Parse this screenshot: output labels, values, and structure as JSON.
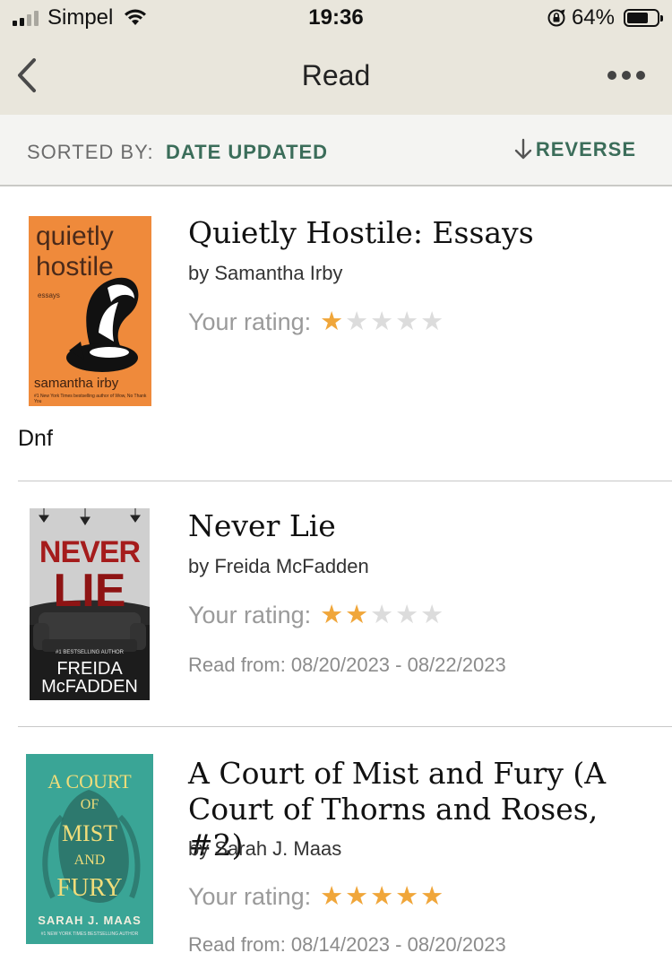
{
  "status_bar": {
    "carrier": "Simpel",
    "time": "19:36",
    "battery_percent": "64%",
    "battery_level": 0.64
  },
  "nav": {
    "title": "Read",
    "back_icon": "chevron-left-icon",
    "more_icon": "more-horizontal-icon"
  },
  "sort": {
    "label": "SORTED BY:",
    "value": "DATE UPDATED",
    "reverse_label": "REVERSE"
  },
  "colors": {
    "accent": "#3b6d5a",
    "star_on": "#f0a63a",
    "star_off": "#dcdcdc",
    "header_bg": "#e9e6dc"
  },
  "books": [
    {
      "title": "Quietly Hostile: Essays",
      "author": "by Samantha Irby",
      "rating_label": "Your rating:",
      "rating": 1,
      "max_rating": 5,
      "read_dates": "",
      "review": "Dnf",
      "cover": {
        "title_line1": "quietly",
        "title_line2": "hostile",
        "subtitle": "essays",
        "author": "samantha irby",
        "tagline": "#1 New York Times bestselling author of Wow, No Thank You"
      }
    },
    {
      "title": "Never Lie",
      "author": "by Freida McFadden",
      "rating_label": "Your rating:",
      "rating": 2,
      "max_rating": 5,
      "read_dates": "Read from: 08/20/2023 - 08/22/2023",
      "review": "",
      "cover": {
        "title_line1": "NEVER",
        "title_line2": "LIE",
        "tagline": "#1 BESTSELLING AUTHOR",
        "author_line1": "FREIDA",
        "author_line2": "McFADDEN"
      }
    },
    {
      "title": "A Court of Mist and Fury (A Court of Thorns and Roses, #2)",
      "author": "by Sarah J. Maas",
      "rating_label": "Your rating:",
      "rating": 5,
      "max_rating": 5,
      "read_dates": "Read from: 08/14/2023 - 08/20/2023",
      "review": "",
      "cover": {
        "line1": "A COURT",
        "line2": "OF",
        "line3": "MIST",
        "line4": "AND",
        "line5": "FURY",
        "author": "SARAH J. MAAS",
        "tagline": "#1 NEW YORK TIMES BESTSELLING AUTHOR"
      }
    }
  ]
}
